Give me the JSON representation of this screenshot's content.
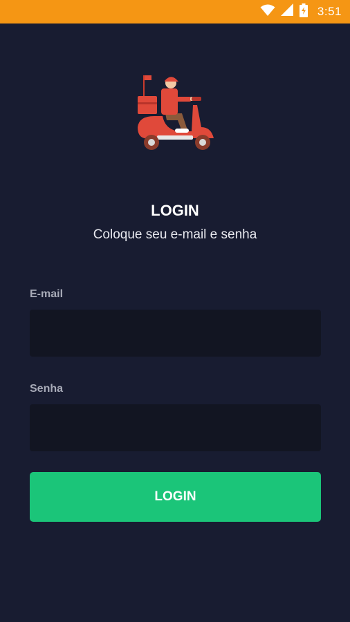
{
  "status_bar": {
    "time": "3:51",
    "icons": [
      "wifi-icon",
      "cellular-signal-icon",
      "battery-charging-icon"
    ],
    "background": "#f59614"
  },
  "header": {
    "logo_icon": "delivery-scooter-icon",
    "title": "LOGIN",
    "subtitle": "Coloque seu e-mail e senha"
  },
  "form": {
    "email": {
      "label": "E-mail",
      "value": "",
      "placeholder": ""
    },
    "password": {
      "label": "Senha",
      "value": "",
      "placeholder": ""
    },
    "submit_label": "LOGIN"
  },
  "colors": {
    "background": "#181c31",
    "input_background": "#121522",
    "accent": "#1bc579",
    "status_bar": "#f59614"
  }
}
